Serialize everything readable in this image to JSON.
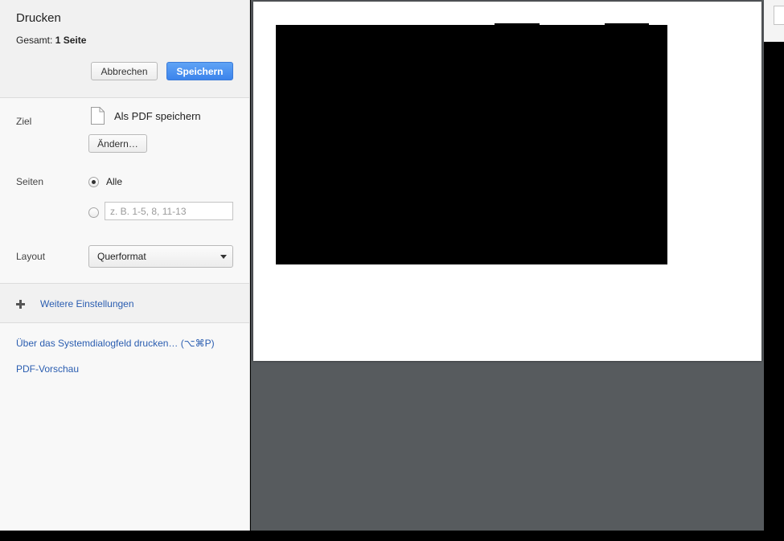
{
  "header": {
    "title": "Drucken",
    "summary_prefix": "Gesamt:",
    "summary_value": "1 Seite",
    "cancel_label": "Abbrechen",
    "save_label": "Speichern"
  },
  "destination": {
    "label": "Ziel",
    "value": "Als PDF speichern",
    "change_label": "Ändern…"
  },
  "pages": {
    "label": "Seiten",
    "option_all": "Alle",
    "selected": "all",
    "range_placeholder": "z. B. 1-5, 8, 11-13",
    "range_value": ""
  },
  "layout": {
    "label": "Layout",
    "selected": "Querformat"
  },
  "more_settings": {
    "label": "Weitere Einstellungen"
  },
  "links": {
    "system_dialog": "Über das Systemdialogfeld drucken… (⌥⌘P)",
    "pdf_preview": "PDF-Vorschau"
  },
  "colors": {
    "primary_button": "#3c84ec",
    "link": "#2a5db0",
    "preview_background": "#575b5e"
  },
  "icons": {
    "destination": "document-icon",
    "more": "plus-icon",
    "dropdown": "chevron-down-icon"
  }
}
